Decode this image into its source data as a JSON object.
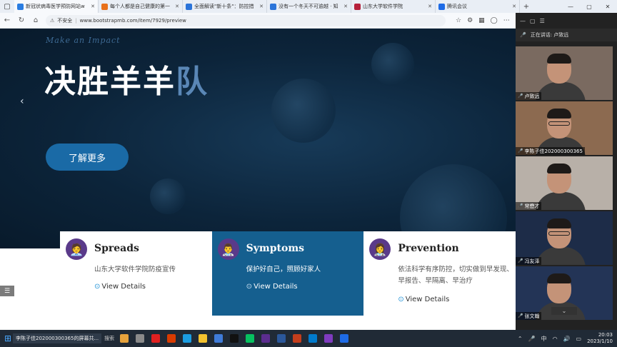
{
  "browser": {
    "tabs": [
      {
        "title": "新冠状病毒医学预防网站w",
        "favicon_color": "#2a7de1",
        "active": true
      },
      {
        "title": "每个人都是自己健康的第一",
        "favicon_color": "#e8701a",
        "active": false
      },
      {
        "title": "全面解读\"新十条\"：防控措",
        "favicon_color": "#2b74d9",
        "active": false
      },
      {
        "title": "没有一个冬天不可逾越 · 知",
        "favicon_color": "#2b74d9",
        "active": false
      },
      {
        "title": "山东大学软件学院",
        "favicon_color": "#b5203a",
        "active": false
      },
      {
        "title": "腾讯会议",
        "favicon_color": "#1e6be6",
        "active": false
      }
    ],
    "security_label": "不安全",
    "url": "www.bootstrapmb.com/item/7929/preview"
  },
  "hero": {
    "tagline": "Make an Impact",
    "headline_main": "决胜羊羊",
    "headline_accent": "队",
    "cta_label": "了解更多"
  },
  "cards": [
    {
      "title": "Spreads",
      "desc": "山东大学软件学院防疫宣传",
      "more": "View Details",
      "avatar": "🧑‍💼"
    },
    {
      "title": "Symptoms",
      "desc": "保护好自己，照顾好家人",
      "more": "View Details",
      "avatar": "👨‍⚕️"
    },
    {
      "title": "Prevention",
      "desc": "依法科学有序防控，切实做到早发现、早报告、早隔离、早治疗",
      "more": "View Details",
      "avatar": "👩‍⚕️"
    }
  ],
  "meeting": {
    "speaking_label": "正在讲话: 卢致远",
    "participants": [
      {
        "name": "卢致远",
        "bg": "#7a6a60"
      },
      {
        "name": "李陈子佳202000300365",
        "bg": "#8c6a50"
      },
      {
        "name": "常懋才",
        "bg": "#b8b0a8"
      },
      {
        "name": "冯友泽",
        "bg": "#1d2c48"
      },
      {
        "name": "张文翰",
        "bg": "#233456"
      }
    ]
  },
  "taskbar": {
    "share_label": "李陈子佳202000300365的屏幕共...",
    "search_label": "搜索",
    "ime_label": "中",
    "time": "20:03",
    "date": "2023/1/10"
  },
  "colors": {
    "hero_bg": "#0c243a",
    "accent_blue": "#1a6aa6",
    "active_card": "#155f8f",
    "headline_accent": "#5a87b6"
  }
}
